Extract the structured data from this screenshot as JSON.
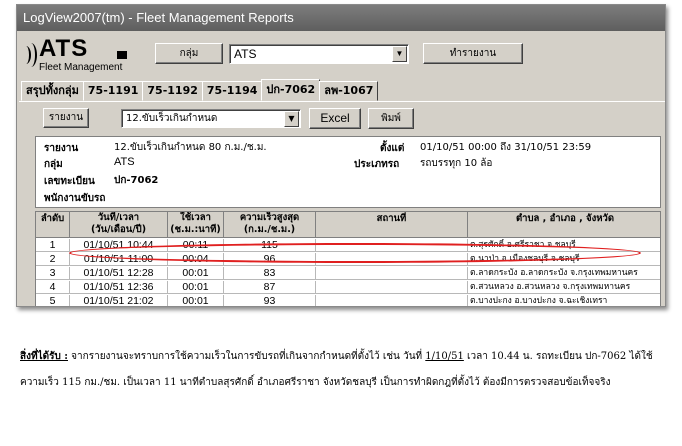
{
  "window": {
    "title": "LogView2007(tm) - Fleet Management Reports"
  },
  "brand": {
    "name": "ATS",
    "subtitle": "Fleet Management"
  },
  "toolbar": {
    "group_label": "กลุ่ม",
    "group_value": "ATS",
    "report_button": "ทำรายงาน"
  },
  "tabs": [
    {
      "label": "สรุปทั้งกลุ่ม",
      "active": false
    },
    {
      "label": "75-1191",
      "active": false
    },
    {
      "label": "75-1192",
      "active": false
    },
    {
      "label": "75-1194",
      "active": false
    },
    {
      "label": "ปก-7062",
      "active": true
    },
    {
      "label": "ลพ-1067",
      "active": false
    }
  ],
  "report_bar": {
    "report_label": "รายงาน",
    "report_value": "12.ขับเร็วเกินกำหนด",
    "excel_label": "Excel",
    "print_label": "พิมพ์"
  },
  "info": {
    "report_key": "รายงาน",
    "report_val": "12.ขับเร็วเกินกำหนด 80 ก.ม./ช.ม.",
    "group_key": "กลุ่ม",
    "group_val": "ATS",
    "plate_key": "เลขทะเบียน",
    "plate_val": "ปก-7062",
    "driver_key": "พนักงานขับรถ",
    "since_key": "ตั้งแต่",
    "since_val": "01/10/51  00:00 ถึง 31/10/51  23:59",
    "type_key": "ประเภทรถ",
    "type_val": "รถบรรทุก 10 ล้อ"
  },
  "table": {
    "headers": {
      "no": "ลำดับ",
      "datetime": "วันที่/เวลา",
      "datetime_sub": "(วัน/เดือน/ปี)",
      "duration": "ใช้เวลา",
      "duration_sub": "(ช.ม.:นาที)",
      "maxspeed": "ความเร็วสูงสุด",
      "maxspeed_sub": "(ก.ม./ช.ม.)",
      "place": "สถานที่",
      "location": "ตำบล , อำเภอ , จังหวัด"
    },
    "rows": [
      {
        "no": "1",
        "datetime": "01/10/51 10:44",
        "duration": "00:11",
        "speed": "115",
        "place": "",
        "location": "ต.สุรศักดิ์ อ.ศรีราชา จ.ชลบุรี"
      },
      {
        "no": "2",
        "datetime": "01/10/51 11:00",
        "duration": "00:04",
        "speed": "96",
        "place": "",
        "location": "ต.นาป่า อ.เมืองชลบุรี จ.ชลบุรี"
      },
      {
        "no": "3",
        "datetime": "01/10/51 12:28",
        "duration": "00:01",
        "speed": "83",
        "place": "",
        "location": "ต.ลาดกระบัง อ.ลาดกระบัง จ.กรุงเทพมหานคร"
      },
      {
        "no": "4",
        "datetime": "01/10/51 12:36",
        "duration": "00:01",
        "speed": "87",
        "place": "",
        "location": "ต.สวนหลวง อ.สวนหลวง จ.กรุงเทพมหานคร"
      },
      {
        "no": "5",
        "datetime": "01/10/51 21:02",
        "duration": "00:01",
        "speed": "93",
        "place": "",
        "location": "ต.บางปะกง อ.บางปะกง จ.ฉะเชิงเทรา"
      }
    ]
  },
  "note": {
    "label": "สิ่งที่ได้รับ :",
    "text_a": " จากรายงานจะทราบการใช้ความเร็วในการขับรถที่เกินจากกำหนดที่ตั้งไว้ เช่น วันที่ ",
    "date": "1/10/51",
    "text_b": " เวลา 10.44 น. รถทะเบียน ปก-7062 ได้ใช้ความเร็ว 115 กม./ชม. เป็นเวลา 11 นาทีตำบลสุรศักดิ์ อำเภอศรีราชา จังหวัดชลบุรี เป็นการทำผิดกฎที่ตั้งไว้ ต้องมีการตรวจสอบข้อเท็จจริง"
  },
  "colors": {
    "highlight": "#e02020",
    "titlebar": "#6a6a6a",
    "panel": "#d4d0c8"
  }
}
